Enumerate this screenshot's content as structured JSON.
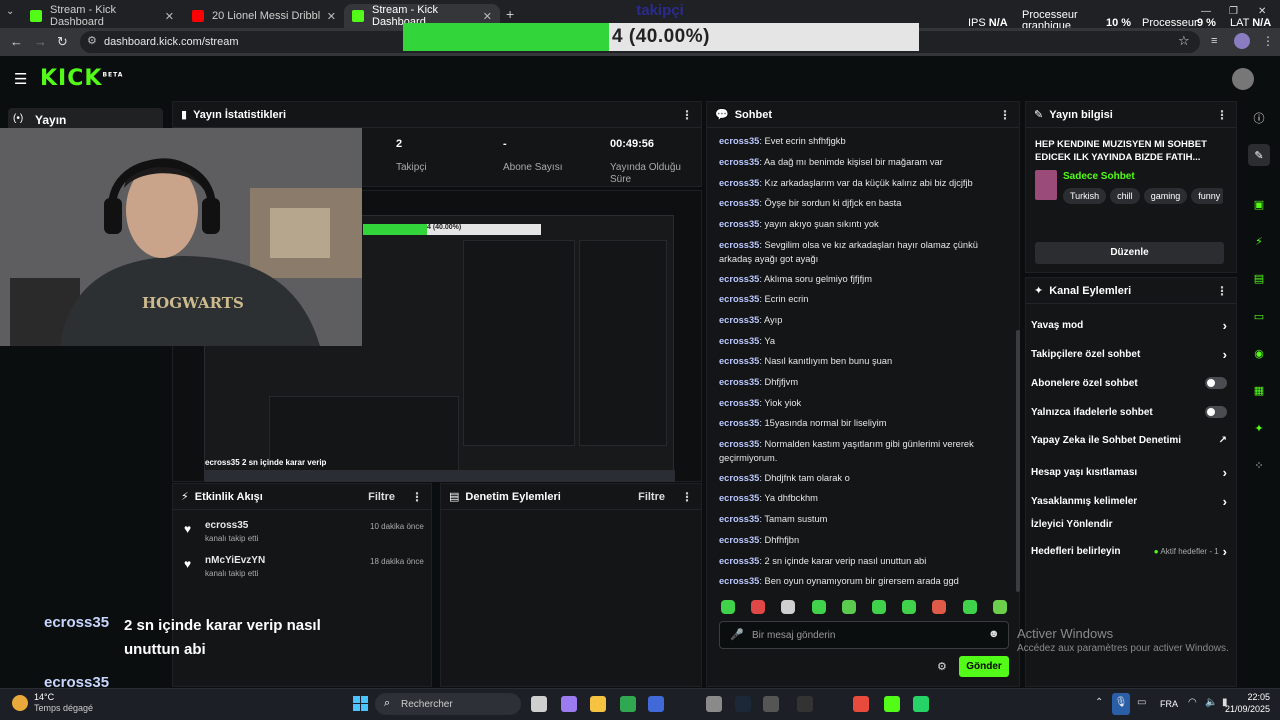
{
  "browser": {
    "tabs": [
      {
        "title": "Stream - Kick Dashboard",
        "favicon_color": "#53fc18"
      },
      {
        "title": "20 Lionel Messi Dribbles That S",
        "favicon_color": "#ff0000"
      },
      {
        "title": "Stream - Kick Dashboard",
        "favicon_color": "#53fc18"
      }
    ],
    "url": "dashboard.kick.com/stream"
  },
  "overlay": {
    "goal_title": "takipçi",
    "progress_text": "4 (40.00%)",
    "progress_fraction": 0.4,
    "ips_label": "IPS",
    "ips_value": "N/A",
    "gpu_label": "Processeur graphique",
    "gpu_value": "10 %",
    "cpu_label": "Processeur",
    "cpu_value": "9 %",
    "lat_label": "LAT",
    "lat_value": "N/A"
  },
  "sidebar": {
    "active_item": "Yayın"
  },
  "stats": {
    "title": "Yayın İstatistikleri",
    "items": [
      {
        "value": "2",
        "label": "Takipçi"
      },
      {
        "value": "-",
        "label": "Abone Sayısı"
      },
      {
        "value": "00:49:56",
        "label": "Yayında Olduğu Süre"
      }
    ]
  },
  "activity": {
    "title": "Etkinlik Akışı",
    "filter": "Filtre",
    "items": [
      {
        "user": "ecross35",
        "action": "kanalı takip etti",
        "time": "10 dakika önce"
      },
      {
        "user": "nMcYiEvzYN",
        "action": "kanalı takip etti",
        "time": "18 dakika önce"
      }
    ]
  },
  "moderation": {
    "title": "Denetim Eylemleri",
    "filter": "Filtre"
  },
  "overlay_chat": {
    "user": "ecross35",
    "message": "2 sn içinde karar verip nasıl unuttun abi",
    "user2": "ecross35"
  },
  "preview": {
    "mini_progress": "4 (40.00%)",
    "mini_caption_user": "ecross35",
    "mini_caption_msg": "2 sn içinde karar verip"
  },
  "chat": {
    "title": "Sohbet",
    "messages": [
      {
        "user": "ecross35",
        "text": "Evet ecrin shfhfjgkb"
      },
      {
        "user": "ecross35",
        "text": "Aa dağ mı benimde kişisel bir mağaram var"
      },
      {
        "user": "ecross35",
        "text": "Kız arkadaşlarım var da küçük kalırız abi biz djcjfjb"
      },
      {
        "user": "ecross35",
        "text": "Öyşe bir sordun ki djfjck en basta"
      },
      {
        "user": "ecross35",
        "text": "yayın akıyo şuan sıkıntı yok"
      },
      {
        "user": "ecross35",
        "text": "Sevgilim olsa ve kız arkadaşları hayır olamaz çünkü arkadaş ayağı got ayağı"
      },
      {
        "user": "ecross35",
        "text": "Aklıma soru gelmiyo fjfjfjm"
      },
      {
        "user": "ecross35",
        "text": "Ecrin ecrin"
      },
      {
        "user": "ecross35",
        "text": "Ayıp"
      },
      {
        "user": "ecross35",
        "text": "Ya"
      },
      {
        "user": "ecross35",
        "text": "Nasıl kanıtlıyım ben bunu şuan"
      },
      {
        "user": "ecross35",
        "text": "Dhfjfjvm"
      },
      {
        "user": "ecross35",
        "text": "Yiok yiok"
      },
      {
        "user": "ecross35",
        "text": "15yasında normal bir liseliyim"
      },
      {
        "user": "ecross35",
        "text": "Normalden kastım yaşıtlarım gibi günlerimi vererek geçirmiyorum."
      },
      {
        "user": "ecross35",
        "text": "Dhdjfnk tam olarak o"
      },
      {
        "user": "ecross35",
        "text": "Ya dhfbckhm"
      },
      {
        "user": "ecross35",
        "text": "Tamam sustum"
      },
      {
        "user": "ecross35",
        "text": "Dhfhfjbn"
      },
      {
        "user": "ecross35",
        "text": "2 sn içinde karar verip nasıl unuttun abi"
      },
      {
        "user": "ecross35",
        "text": "Ben oyun oynamıyorum bir girersem arada ggd"
      }
    ],
    "input_placeholder": "Bir mesaj gönderin",
    "send_label": "Gönder"
  },
  "stream_info": {
    "title": "Yayın bilgisi",
    "stream_title": "HEP KENDINE MUZISYEN MI SOHBET EDICEK ILK YAYINDA BIZDE FATIH...",
    "category": "Sadece Sohbet",
    "tags": [
      "Turkish",
      "chill",
      "gaming",
      "funny"
    ],
    "edit_label": "Düzenle"
  },
  "channel_actions": {
    "title": "Kanal Eylemleri",
    "items": [
      {
        "label": "Yavaş mod",
        "control": "chevron"
      },
      {
        "label": "Takipçilere özel sohbet",
        "control": "chevron"
      },
      {
        "label": "Abonelere özel sohbet",
        "control": "toggle"
      },
      {
        "label": "Yalnızca ifadelerle sohbet",
        "control": "toggle"
      },
      {
        "label": "Yapay Zeka ile Sohbet Denetimi",
        "control": "external"
      },
      {
        "label": "Hesap yaşı kısıtlaması",
        "control": "chevron"
      },
      {
        "label": "Yasaklanmış kelimeler",
        "control": "chevron"
      },
      {
        "label": "İzleyici Yönlendir",
        "control": "none"
      },
      {
        "label": "Hedefleri belirleyin",
        "control": "chevron",
        "badge": "Aktif hedefler - 1"
      }
    ]
  },
  "windows": {
    "activate_title": "Activer Windows",
    "activate_sub": "Accédez aux paramètres pour activer Windows.",
    "weather_temp": "14°C",
    "weather_desc": "Temps dégagé",
    "search_placeholder": "Rechercher",
    "lang": "FRA",
    "time": "22:05",
    "date": "21/09/2025"
  }
}
